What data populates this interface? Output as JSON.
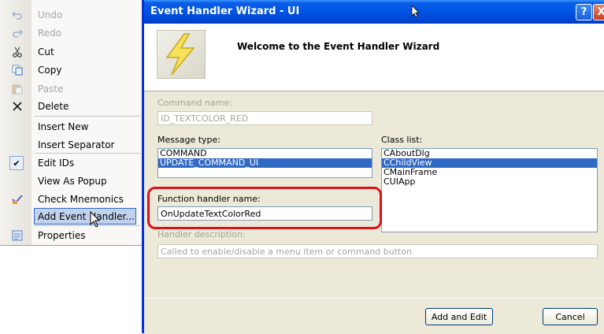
{
  "menu": {
    "items": [
      {
        "label": "Undo",
        "icon": "undo-icon"
      },
      {
        "label": "Redo",
        "icon": "redo-icon"
      },
      {
        "label": "Cut",
        "icon": "scissors-icon"
      },
      {
        "label": "Copy",
        "icon": "copy-icon"
      },
      {
        "label": "Paste",
        "icon": "paste-icon"
      },
      {
        "label": "Delete",
        "icon": "delete-x-icon"
      },
      {
        "label": "Insert New"
      },
      {
        "label": "Insert Separator"
      },
      {
        "label": "Edit IDs",
        "checked": true
      },
      {
        "label": "View As Popup"
      },
      {
        "label": "Check Mnemonics",
        "icon": "check-mnemonics-icon"
      },
      {
        "label": "Add Event Handler...",
        "highlighted": true
      },
      {
        "label": "Properties",
        "icon": "properties-icon"
      }
    ]
  },
  "dialog": {
    "title": "Event Handler Wizard - UI",
    "help_button": "?",
    "close_button": "X",
    "banner_title": "Welcome to the Event Handler Wizard",
    "command_name_label": "Command name:",
    "command_name_value": "ID_TEXTCOLOR_RED",
    "message_type_label": "Message type:",
    "message_types": [
      "COMMAND",
      "UPDATE_COMMAND_UI"
    ],
    "selected_message_type": "UPDATE_COMMAND_UI",
    "class_list_label": "Class list:",
    "classes": [
      "CAboutDlg",
      "CChildView",
      "CMainFrame",
      "CUIApp"
    ],
    "selected_class": "CChildView",
    "function_handler_label": "Function handler name:",
    "function_handler_value": "OnUpdateTextColorRed",
    "handler_description_label": "Handler description:",
    "handler_description_value": "Called to enable/disable a menu item or command button",
    "add_edit_button": "Add and Edit",
    "cancel_button": "Cancel"
  },
  "colors": {
    "title_bar": "#0055e5",
    "selection": "#316ac5",
    "highlight_box": "#e0101a"
  }
}
